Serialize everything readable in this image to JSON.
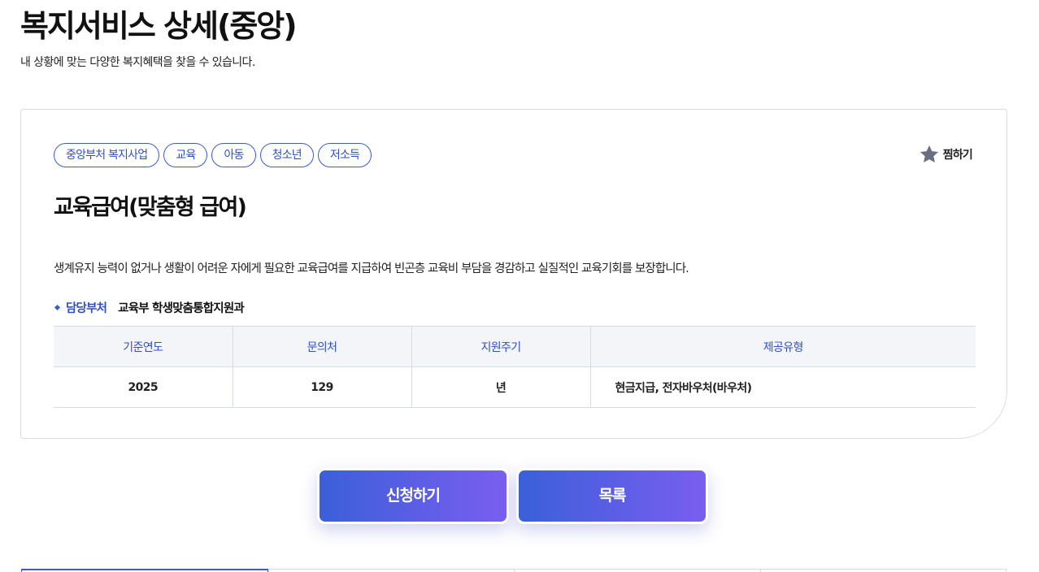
{
  "header": {
    "title": "복지서비스 상세(중앙)",
    "subtitle": "내 상황에 맞는 다양한 복지혜택을 찾을 수 있습니다."
  },
  "service": {
    "tags": [
      "중앙부처 복지사업",
      "교육",
      "아동",
      "청소년",
      "저소득"
    ],
    "favorite_label": "찜하기",
    "title": "교육급여(맞춤형 급여)",
    "description": "생계유지 능력이 없거나 생활이 어려운 자에게 필요한 교육급여를 지급하여 빈곤층 교육비 부담을 경감하고 실질적인 교육기회를 보장합니다.",
    "department_label": "담당부처",
    "department_value": "교육부 학생맞춤통합지원과",
    "table": {
      "headers": [
        "기준연도",
        "문의처",
        "지원주기",
        "제공유형"
      ],
      "row": [
        "2025",
        "129",
        "년",
        "현금지급, 전자바우처(바우처)"
      ]
    }
  },
  "actions": {
    "apply_label": "신청하기",
    "list_label": "목록"
  },
  "colors": {
    "accent": "#3a5bd1",
    "button_gradient_start": "#3b5fd9",
    "button_gradient_end": "#7a5ef0",
    "star": "#6b6e80"
  },
  "icons": {
    "favorite": "star-icon",
    "department_bullet": "diamond-bullet-icon"
  }
}
